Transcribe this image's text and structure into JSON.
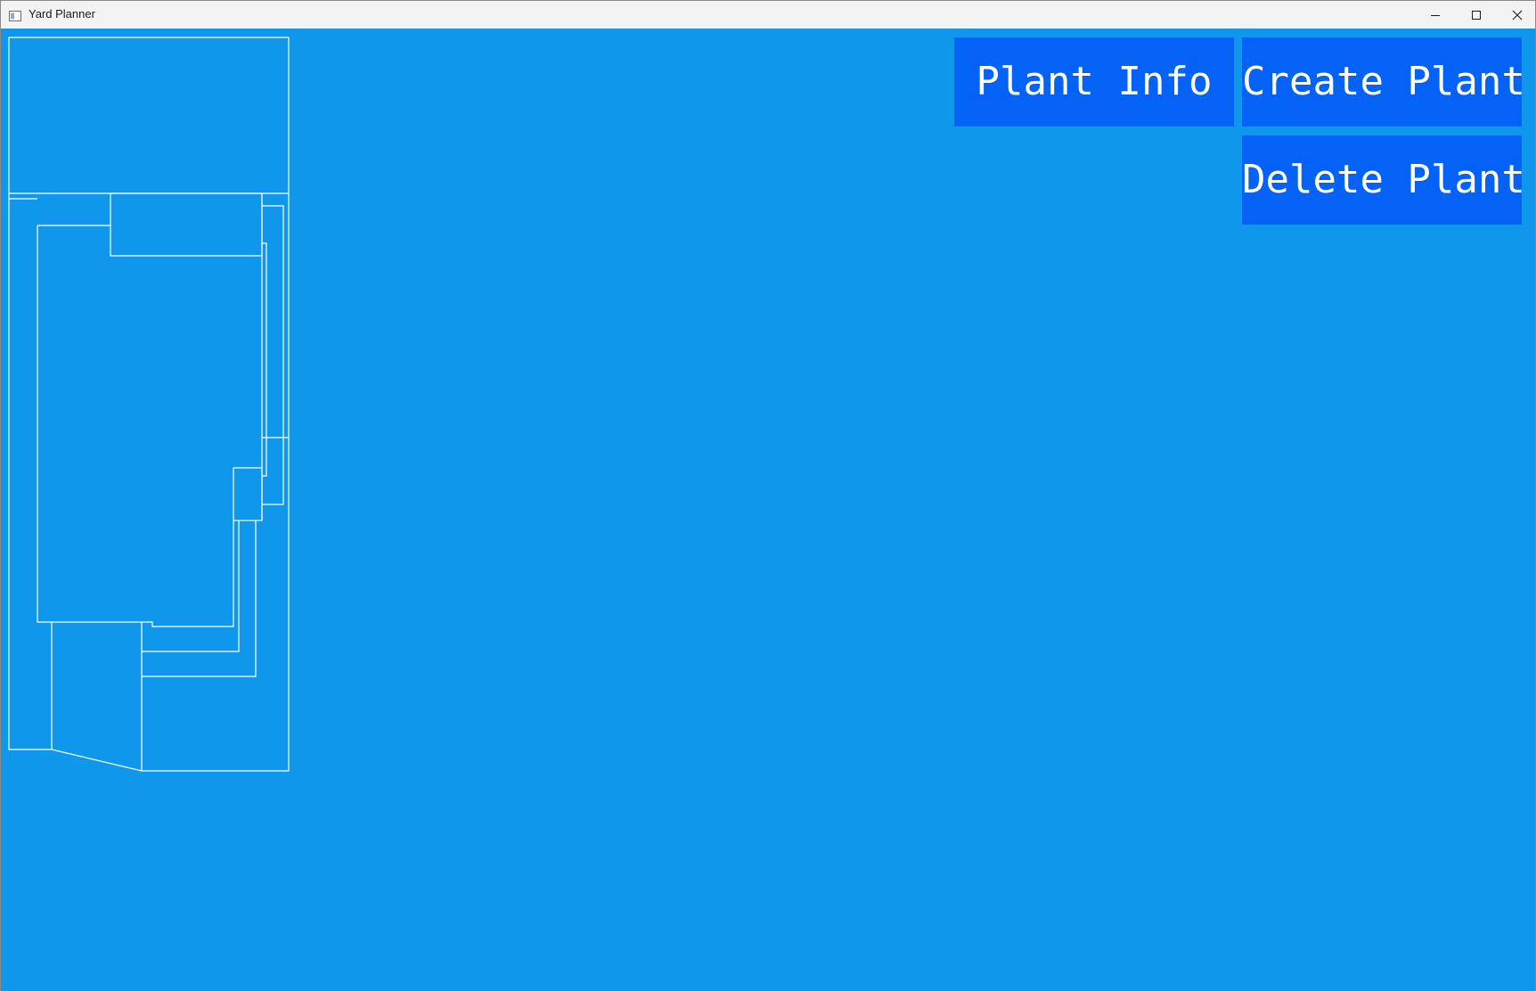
{
  "window": {
    "title": "Yard Planner",
    "controls": {
      "minimize": "minimize-icon",
      "maximize": "maximize-icon",
      "close": "close-icon"
    }
  },
  "toolbar": {
    "plant_info_label": "Plant Info",
    "create_plant_label": "Create Plant",
    "delete_plant_label": "Delete Plant"
  },
  "colors": {
    "canvas_background": "#0e97eb",
    "button_background": "#0463f6",
    "button_text": "#ffffff",
    "map_lines": "#ffffff"
  }
}
